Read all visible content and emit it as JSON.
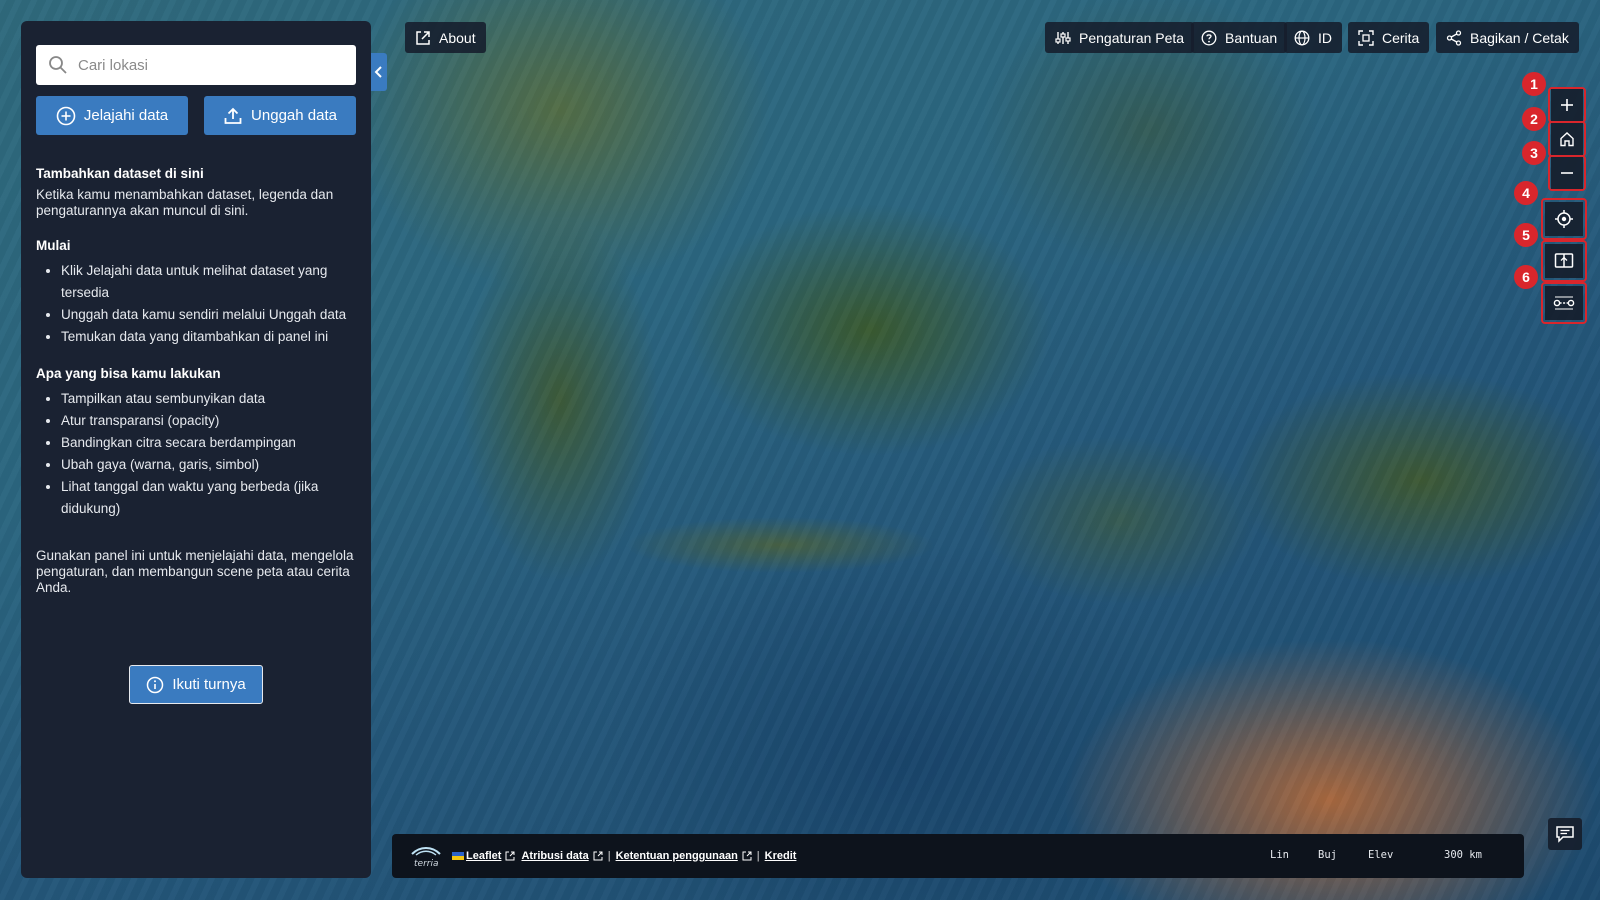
{
  "panel": {
    "search_placeholder": "Cari lokasi",
    "explore_label": "Jelajahi data",
    "upload_label": "Unggah data",
    "add_title": "Tambahkan dataset di sini",
    "add_desc": "Ketika kamu menambahkan dataset, legenda dan pengaturannya akan muncul di sini.",
    "start_title": "Mulai",
    "start_items": [
      "Klik Jelajahi data untuk melihat dataset yang tersedia",
      "Unggah data kamu sendiri melalui Unggah data",
      "Temukan data yang ditambahkan di panel ini"
    ],
    "can_title": "Apa yang bisa kamu lakukan",
    "can_items": [
      "Tampilkan atau sembunyikan data",
      "Atur transparansi (opacity)",
      "Bandingkan citra secara berdampingan",
      "Ubah gaya (warna, garis, simbol)",
      "Lihat tanggal dan waktu yang berbeda (jika didukung)"
    ],
    "outro": "Gunakan panel ini untuk menjelajahi data, mengelola pengaturan, dan membangun scene peta atau cerita Anda.",
    "tour_label": "Ikuti turnya"
  },
  "toolbar": {
    "about": "About",
    "map_settings": "Pengaturan Peta",
    "help": "Bantuan",
    "language": "ID",
    "story": "Cerita",
    "share": "Bagikan / Cetak"
  },
  "controls": {
    "badges": [
      "1",
      "2",
      "3",
      "4",
      "5",
      "6"
    ],
    "accent": "#d9262c"
  },
  "bottom": {
    "logo_text": "terria",
    "leaflet": "Leaflet",
    "attribution": "Atribusi data",
    "terms": "Ketentuan penggunaan",
    "credits": "Kredit",
    "separator": "|",
    "lat_label": "Lin",
    "lon_label": "Buj",
    "elev_label": "Elev",
    "scale": "300 km"
  },
  "colors": {
    "primary": "#3a7bc0",
    "panel_bg": "#1a2232",
    "highlight": "#d9262c"
  }
}
